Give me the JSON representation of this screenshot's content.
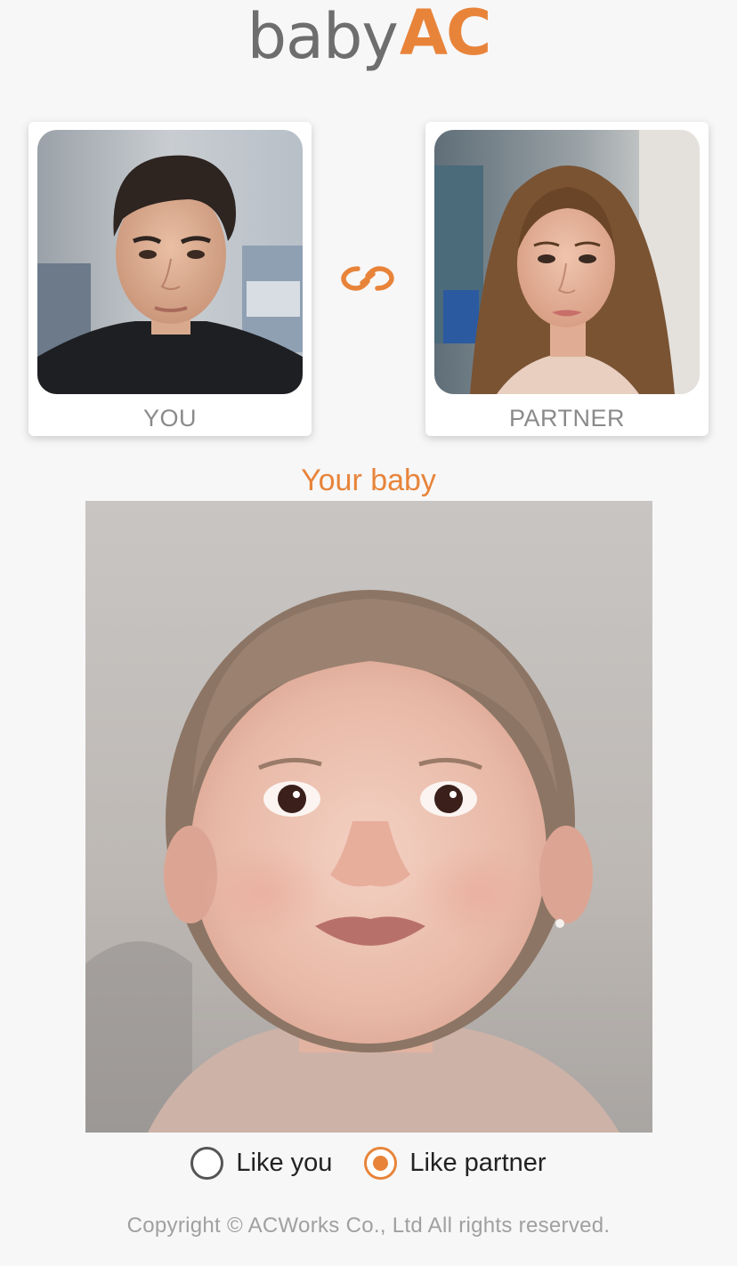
{
  "logo": {
    "part1": "baby",
    "part2": "AC"
  },
  "parents": {
    "you": {
      "label": "YOU",
      "photo_icon": "male-portrait-photo"
    },
    "partner": {
      "label": "PARTNER",
      "photo_icon": "female-portrait-photo"
    }
  },
  "link_icon": "infinity-link-icon",
  "result": {
    "title": "Your baby",
    "photo_icon": "baby-portrait-photo"
  },
  "options": [
    {
      "label": "Like you",
      "selected": false
    },
    {
      "label": "Like partner",
      "selected": true
    }
  ],
  "footer": {
    "copyright": "Copyright © ACWorks Co., Ltd All rights reserved."
  },
  "colors": {
    "accent": "#e8843a",
    "logo_gray": "#6e6e6e",
    "background": "#f7f7f8"
  }
}
